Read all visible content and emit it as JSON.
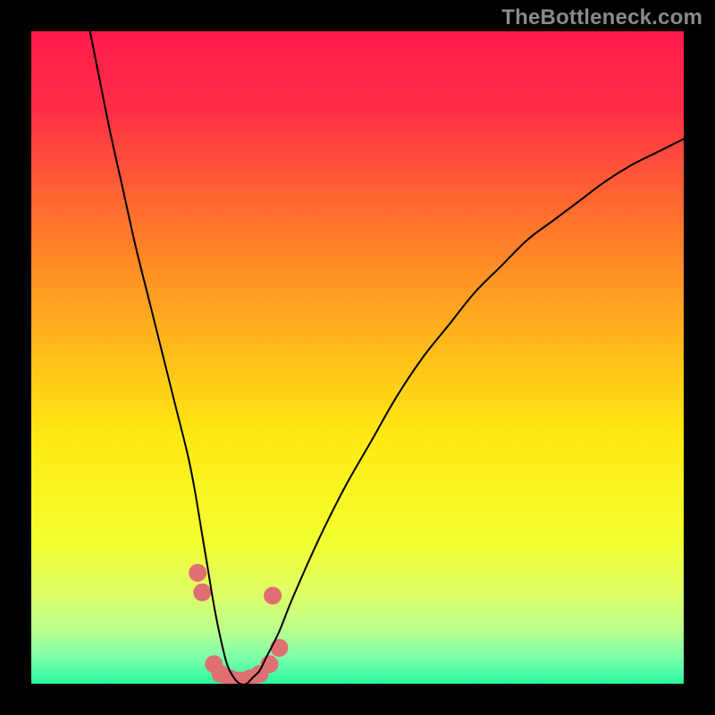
{
  "watermark": {
    "text": "TheBottleneck.com"
  },
  "chart_data": {
    "type": "line",
    "title": "",
    "xlabel": "",
    "ylabel": "",
    "xlim": [
      0,
      100
    ],
    "ylim": [
      0,
      100
    ],
    "grid": false,
    "legend": false,
    "gradient_stops": [
      {
        "offset": 0.0,
        "color": "#ff1a4b"
      },
      {
        "offset": 0.12,
        "color": "#ff2f46"
      },
      {
        "offset": 0.28,
        "color": "#ff6f2f"
      },
      {
        "offset": 0.46,
        "color": "#ffb21c"
      },
      {
        "offset": 0.62,
        "color": "#ffe913"
      },
      {
        "offset": 0.78,
        "color": "#f3ff2e"
      },
      {
        "offset": 0.86,
        "color": "#e0ff65"
      },
      {
        "offset": 0.92,
        "color": "#b7ff8f"
      },
      {
        "offset": 0.96,
        "color": "#7dffab"
      },
      {
        "offset": 1.0,
        "color": "#27f99e"
      }
    ],
    "series": [
      {
        "name": "bottleneck-curve",
        "color": "#000000",
        "stroke_width": 2,
        "x": [
          9,
          10,
          12,
          14,
          16,
          18,
          20,
          22,
          24,
          25,
          26,
          27,
          28,
          29,
          30,
          31,
          32,
          33,
          34,
          35,
          36,
          38,
          40,
          44,
          48,
          52,
          56,
          60,
          64,
          68,
          72,
          76,
          80,
          84,
          88,
          92,
          96,
          100
        ],
        "values": [
          100,
          95,
          85,
          76,
          67,
          59,
          51,
          43,
          35,
          30,
          24,
          18,
          12,
          7,
          3,
          1,
          0,
          0,
          1,
          2,
          4,
          8,
          13,
          22,
          30,
          37,
          44,
          50,
          55,
          60,
          64,
          68,
          71,
          74,
          77,
          79.5,
          81.5,
          83.5
        ]
      }
    ],
    "markers": {
      "name": "curve-dots",
      "color": "#e06f74",
      "radius": 10,
      "points": [
        {
          "x": 25.5,
          "y": 17
        },
        {
          "x": 26.2,
          "y": 14
        },
        {
          "x": 28.0,
          "y": 3.0
        },
        {
          "x": 29.0,
          "y": 1.5
        },
        {
          "x": 30.5,
          "y": 0.8
        },
        {
          "x": 32.0,
          "y": 0.5
        },
        {
          "x": 33.5,
          "y": 0.8
        },
        {
          "x": 35.0,
          "y": 1.5
        },
        {
          "x": 36.5,
          "y": 3.0
        },
        {
          "x": 38.0,
          "y": 5.5
        },
        {
          "x": 37.0,
          "y": 13.5
        }
      ]
    }
  }
}
